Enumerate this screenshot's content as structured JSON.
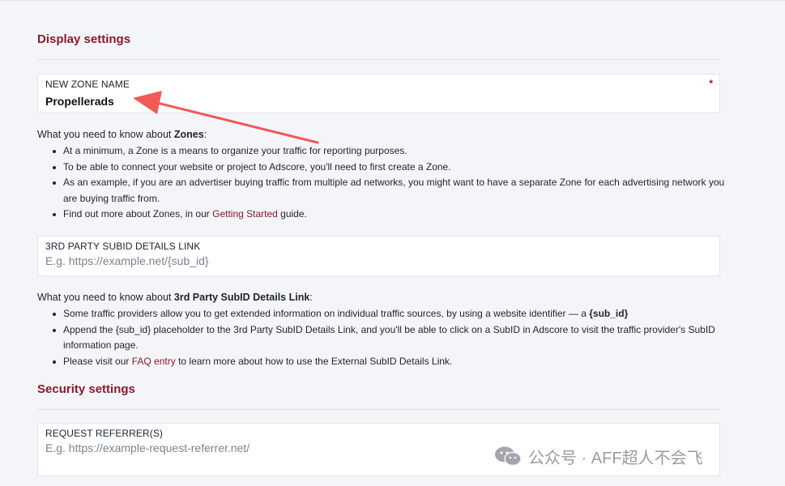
{
  "display_settings": {
    "title": "Display settings",
    "zone_name": {
      "label": "NEW ZONE NAME",
      "value": "Propellerads",
      "required_mark": "*"
    },
    "zones_info": {
      "prefix": "What you need to know about ",
      "bold": "Zones",
      "suffix": ":",
      "items": [
        "At a minimum, a Zone is a means to organize your traffic for reporting purposes.",
        "To be able to connect your website or project to Adscore, you'll need to first create a Zone.",
        "As an example, if you are an advertiser buying traffic from multiple ad networks, you might want to have a separate Zone for each advertising network you are buying traffic from."
      ],
      "last_item": {
        "prefix": "Find out more about Zones, in our ",
        "link": "Getting Started",
        "suffix": " guide."
      }
    },
    "subid_link": {
      "label": "3RD PARTY SUBID DETAILS LINK",
      "placeholder": "E.g. https://example.net/{sub_id}"
    },
    "subid_info": {
      "prefix": "What you need to know about ",
      "bold": "3rd Party SubID Details Link",
      "suffix": ":",
      "item1": {
        "text": "Some traffic providers allow you to get extended information on individual traffic sources, by using a website identifier — a ",
        "bold": "{sub_id}"
      },
      "item2": "Append the {sub_id} placeholder to the 3rd Party SubID Details Link, and you'll be able to click on a SubID in Adscore to visit the traffic provider's SubID information page.",
      "item3": {
        "prefix": "Please visit our ",
        "link": "FAQ entry",
        "suffix": " to learn more about how to use the External SubID Details Link."
      }
    }
  },
  "security_settings": {
    "title": "Security settings",
    "request_referrer": {
      "label": "REQUEST REFERRER(S)",
      "placeholder": "E.g. https://example-request-referrer.net/"
    }
  },
  "watermark": {
    "icon": "wechat-icon",
    "text": "公众号 · AFF超人不会飞"
  },
  "colors": {
    "accent": "#8b1a2b",
    "annotation_arrow": "#f05a57",
    "background": "#f4f5f9"
  }
}
